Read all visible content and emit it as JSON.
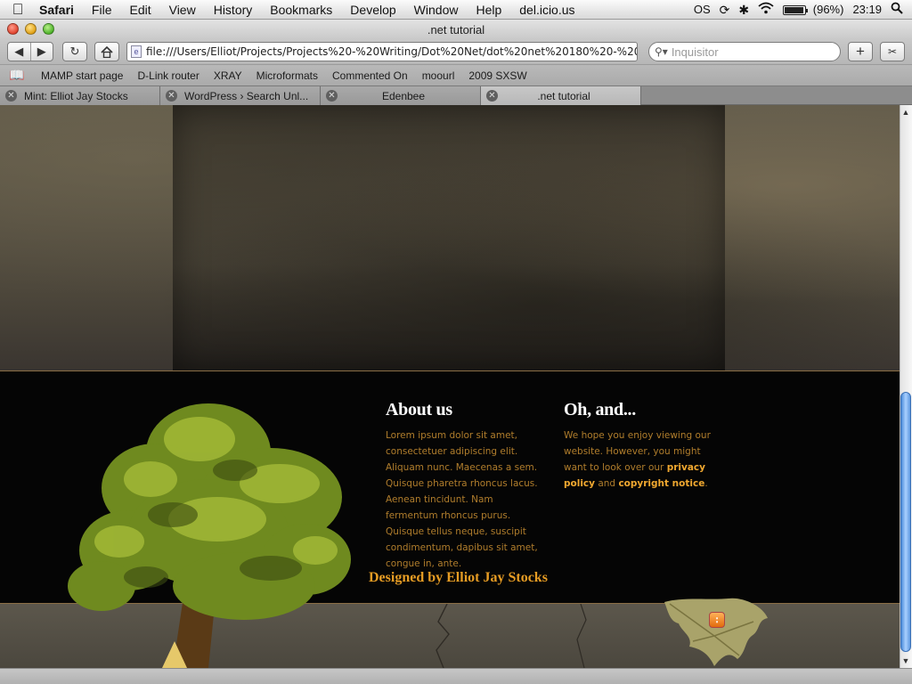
{
  "menubar": {
    "app": "Safari",
    "items": [
      "File",
      "Edit",
      "View",
      "History",
      "Bookmarks",
      "Develop",
      "Window",
      "Help",
      "del.icio.us"
    ],
    "status": {
      "os_label": "OS",
      "battery": "(96%)",
      "battery_level": 0.96,
      "clock": "23:19"
    }
  },
  "window": {
    "title": ".net tutorial"
  },
  "toolbar": {
    "url": "file:///Users/Elliot/Projects/Projects%20-%20Writing/Dot%20Net/dot%20net%20180%20-%20",
    "search_placeholder": "Inquisitor"
  },
  "bookmarks": [
    "MAMP start page",
    "D-Link router",
    "XRAY",
    "Microformats",
    "Commented On",
    "moourl",
    "2009 SXSW"
  ],
  "tabs": [
    {
      "label": "Mint: Elliot Jay Stocks",
      "active": false
    },
    {
      "label": "WordPress › Search Unl...",
      "active": false
    },
    {
      "label": "Edenbee",
      "active": false
    },
    {
      "label": ".net tutorial",
      "active": true
    }
  ],
  "page": {
    "about": {
      "title": "About us",
      "text": "Lorem ipsum dolor sit amet, consectetuer adipiscing elit. Aliquam nunc. Maecenas a sem. Quisque pharetra rhoncus lacus. Aenean tincidunt. Nam fermentum rhoncus purus. Quisque tellus neque, suscipit condimentum, dapibus sit amet, congue in, ante."
    },
    "oh_and": {
      "title": "Oh, and...",
      "text_before": "We hope you enjoy viewing our website. However, you might want to look over our ",
      "privacy_link": "privacy policy",
      "middle": " and ",
      "copyright_link": "copyright notice",
      "text_after": "."
    },
    "designed_by": "Designed by Elliot Jay Stocks"
  },
  "colors": {
    "accent_text": "#b07d2c",
    "link": "#f0a830",
    "heading": "#ffffff",
    "band": "#050505"
  }
}
